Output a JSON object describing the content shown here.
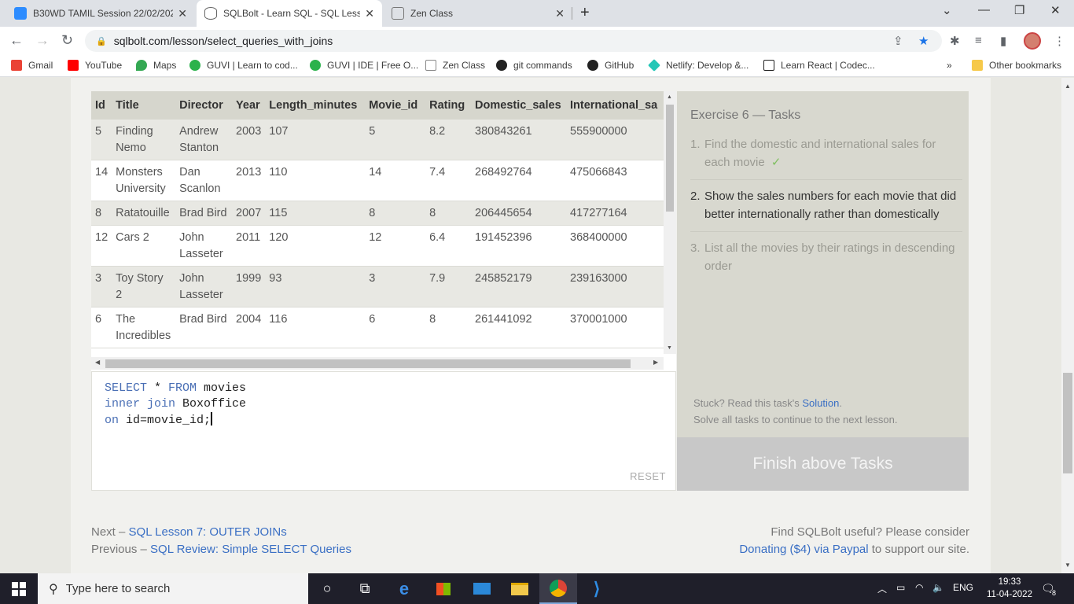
{
  "browser": {
    "tabs": [
      {
        "title": "B30WD TAMIL Session 22/02/202",
        "favicon_color": "#2d8cff",
        "active": false
      },
      {
        "title": "SQLBolt - Learn SQL - SQL Lesso",
        "favicon_color": "#7a7a7a",
        "active": true
      },
      {
        "title": "Zen Class",
        "favicon_color": "#9a9a9a",
        "active": false
      }
    ],
    "url": "sqlbolt.com/lesson/select_queries_with_joins",
    "bookmarks": [
      {
        "label": "Gmail",
        "color": "#ea4335"
      },
      {
        "label": "YouTube",
        "color": "#ff0000"
      },
      {
        "label": "Maps",
        "color": "#34a853"
      },
      {
        "label": "GUVI | Learn to cod...",
        "color": "#2bb24c"
      },
      {
        "label": "GUVI | IDE | Free O...",
        "color": "#2bb24c"
      },
      {
        "label": "Zen Class",
        "color": "#888888"
      },
      {
        "label": "git commands",
        "color": "#222222"
      },
      {
        "label": "GitHub",
        "color": "#222222"
      },
      {
        "label": "Netlify: Develop &...",
        "color": "#25c7b7"
      },
      {
        "label": "Learn React | Codec...",
        "color": "#1f1f1f"
      }
    ],
    "other_bookmarks": "Other bookmarks"
  },
  "results": {
    "columns": [
      "Id",
      "Title",
      "Director",
      "Year",
      "Length_minutes",
      "Movie_id",
      "Rating",
      "Domestic_sales",
      "International_sa"
    ],
    "rows": [
      [
        "5",
        "Finding Nemo",
        "Andrew Stanton",
        "2003",
        "107",
        "5",
        "8.2",
        "380843261",
        "555900000"
      ],
      [
        "14",
        "Monsters University",
        "Dan Scanlon",
        "2013",
        "110",
        "14",
        "7.4",
        "268492764",
        "475066843"
      ],
      [
        "8",
        "Ratatouille",
        "Brad Bird",
        "2007",
        "115",
        "8",
        "8",
        "206445654",
        "417277164"
      ],
      [
        "12",
        "Cars 2",
        "John Lasseter",
        "2011",
        "120",
        "12",
        "6.4",
        "191452396",
        "368400000"
      ],
      [
        "3",
        "Toy Story 2",
        "John Lasseter",
        "1999",
        "93",
        "3",
        "7.9",
        "245852179",
        "239163000"
      ],
      [
        "6",
        "The Incredibles",
        "Brad Bird",
        "2004",
        "116",
        "6",
        "8",
        "261441092",
        "370001000"
      ]
    ]
  },
  "editor": {
    "line1_kw1": "SELECT",
    "line1_rest": " * ",
    "line1_kw2": "FROM",
    "line1_end": " movies",
    "line2_kw": "inner join",
    "line2_end": " Boxoffice",
    "line3_kw": "on",
    "line3_end": " id=movie_id;",
    "reset_label": "RESET"
  },
  "tasks": {
    "heading": "Exercise 6 — Tasks",
    "items": [
      {
        "num": "1.",
        "text": "Find the domestic and international sales for each movie",
        "status": "done",
        "check": "✓"
      },
      {
        "num": "2.",
        "text": "Show the sales numbers for each movie that did better internationally rather than domestically",
        "status": "current"
      },
      {
        "num": "3.",
        "text": "List all the movies by their ratings in descending order",
        "status": "pending"
      }
    ],
    "stuck_prefix": "Stuck? Read this task's ",
    "solution_link": "Solution",
    "stuck_suffix": ".",
    "solve_all": "Solve all tasks to continue to the next lesson.",
    "finish_label": "Finish above Tasks"
  },
  "footer": {
    "next_prefix": "Next – ",
    "next_link": "SQL Lesson 7: OUTER JOINs",
    "prev_prefix": "Previous – ",
    "prev_link": "SQL Review: Simple SELECT Queries",
    "useful_text": "Find SQLBolt useful? Please consider",
    "donate_link": "Donating ($4) via Paypal",
    "donate_suffix": " to support our site."
  },
  "taskbar": {
    "search_placeholder": "Type here to search",
    "lang": "ENG",
    "time": "19:33",
    "date": "11-04-2022",
    "notif_count": "8"
  }
}
